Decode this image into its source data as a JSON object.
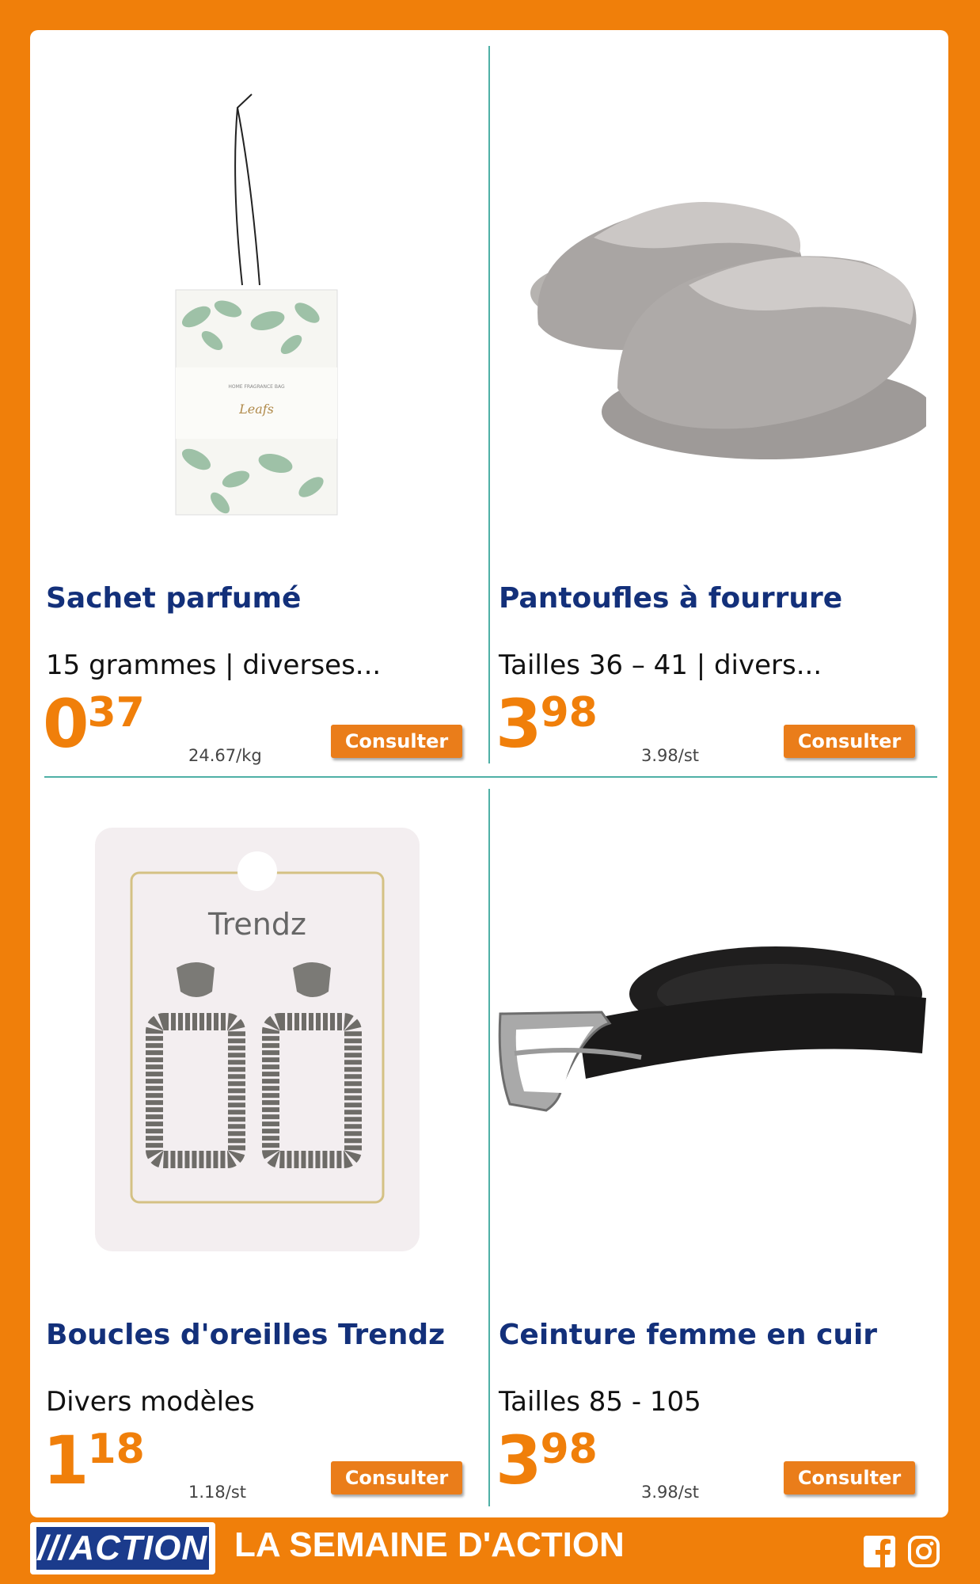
{
  "products": [
    {
      "title": "Sachet parfumé",
      "desc": "15 grammes | diverses...",
      "price_int": "0",
      "price_dec": "37",
      "unit": "24.67/kg",
      "button": "Consulter",
      "img_text_small": "HOME FRAGRANCE BAG",
      "img_text_name": "Leafs"
    },
    {
      "title": "Pantoufles à fourrure",
      "desc": "Tailles 36 – 41 | divers...",
      "price_int": "3",
      "price_dec": "98",
      "unit": "3.98/st",
      "button": "Consulter"
    },
    {
      "title": "Boucles d'oreilles Trendz",
      "desc": "Divers modèles",
      "price_int": "1",
      "price_dec": "18",
      "unit": "1.18/st",
      "button": "Consulter",
      "img_text_brand": "Trendz"
    },
    {
      "title": "Ceinture femme en cuir",
      "desc": "Tailles 85 - 105",
      "price_int": "3",
      "price_dec": "98",
      "unit": "3.98/st",
      "button": "Consulter"
    }
  ],
  "footer": {
    "logo": "///ACTION",
    "slogan": "LA SEMAINE D'ACTION"
  },
  "social": [
    "facebook-icon",
    "instagram-icon"
  ],
  "colors": {
    "orange": "#f07f0a",
    "navy": "#13307a",
    "divider": "#4fb0a6"
  }
}
